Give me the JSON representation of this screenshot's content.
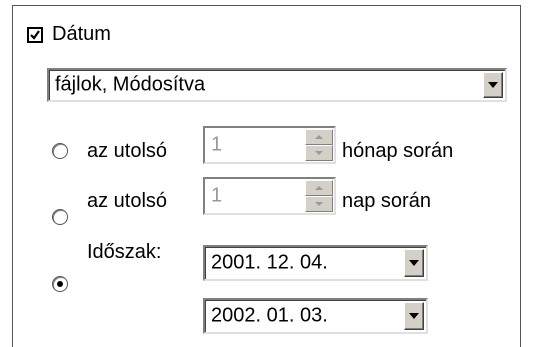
{
  "date_filter": {
    "checkbox_label": "Dátum",
    "checked": true,
    "type_select_value": "fájlok, Módosítva",
    "options": [
      {
        "label": "az utolsó",
        "value": "1",
        "suffix": "hónap során",
        "selected": false
      },
      {
        "label": "az utolsó",
        "value": "1",
        "suffix": "nap során",
        "selected": false
      },
      {
        "label": "Időszak:",
        "selected": true
      }
    ],
    "period_from": "2001. 12. 04.",
    "period_to": "2002. 01. 03."
  }
}
